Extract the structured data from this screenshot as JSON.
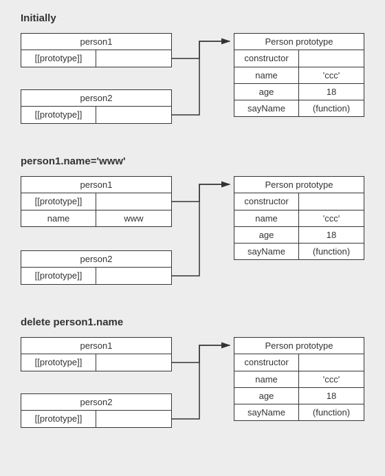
{
  "sections": [
    {
      "title": "Initially",
      "person1": {
        "label": "person1",
        "rows": [
          [
            "[[prototype]]",
            ""
          ]
        ]
      },
      "person2": {
        "label": "person2",
        "rows": [
          [
            "[[prototype]]",
            ""
          ]
        ]
      },
      "proto": {
        "label": "Person prototype",
        "rows": [
          [
            "constructor",
            ""
          ],
          [
            "name",
            "'ccc'"
          ],
          [
            "age",
            "18"
          ],
          [
            "sayName",
            "(function)"
          ]
        ]
      }
    },
    {
      "title": "person1.name='www'",
      "person1": {
        "label": "person1",
        "rows": [
          [
            "[[prototype]]",
            ""
          ],
          [
            "name",
            "www"
          ]
        ]
      },
      "person2": {
        "label": "person2",
        "rows": [
          [
            "[[prototype]]",
            ""
          ]
        ]
      },
      "proto": {
        "label": "Person prototype",
        "rows": [
          [
            "constructor",
            ""
          ],
          [
            "name",
            "'ccc'"
          ],
          [
            "age",
            "18"
          ],
          [
            "sayName",
            "(function)"
          ]
        ]
      }
    },
    {
      "title": "delete person1.name",
      "person1": {
        "label": "person1",
        "rows": [
          [
            "[[prototype]]",
            ""
          ]
        ]
      },
      "person2": {
        "label": "person2",
        "rows": [
          [
            "[[prototype]]",
            ""
          ]
        ]
      },
      "proto": {
        "label": "Person prototype",
        "rows": [
          [
            "constructor",
            ""
          ],
          [
            "name",
            "'ccc'"
          ],
          [
            "age",
            "18"
          ],
          [
            "sayName",
            "(function)"
          ]
        ]
      }
    }
  ]
}
